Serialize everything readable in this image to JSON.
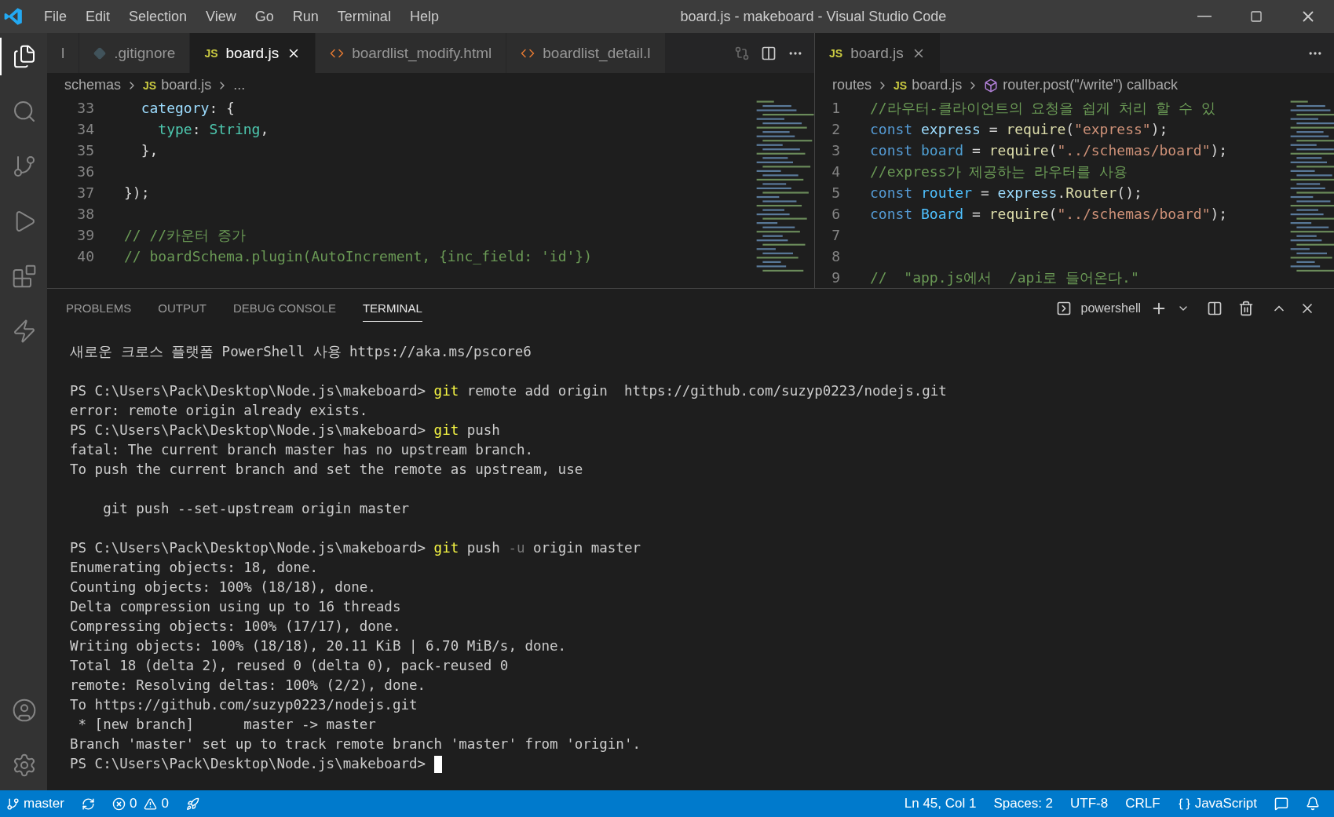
{
  "window": {
    "title": "board.js - makeboard - Visual Studio Code"
  },
  "menu": [
    "File",
    "Edit",
    "Selection",
    "View",
    "Go",
    "Run",
    "Terminal",
    "Help"
  ],
  "activity_bar": [
    {
      "kind": "files",
      "selected": true
    },
    {
      "kind": "search",
      "selected": false
    },
    {
      "kind": "source-control",
      "selected": false
    },
    {
      "kind": "run",
      "selected": false
    },
    {
      "kind": "extensions",
      "selected": false
    },
    {
      "kind": "bolt",
      "selected": false
    }
  ],
  "left_editor": {
    "tabs": [
      {
        "label": "l",
        "kind": "partial",
        "selected": false
      },
      {
        "label": ".gitignore",
        "kind": "git",
        "selected": false
      },
      {
        "label": "board.js",
        "kind": "js",
        "badge": "JS",
        "selected": true
      },
      {
        "label": "boardlist_modify.html",
        "kind": "html",
        "selected": false
      },
      {
        "label": "boardlist_detail.l",
        "kind": "html",
        "selected": false
      }
    ],
    "breadcrumb": [
      {
        "text": "schemas"
      },
      {
        "text": "board.js",
        "badge": "JS"
      },
      {
        "text": "..."
      }
    ],
    "lines": [
      {
        "number": "33",
        "tokens": [
          {
            "t": "  category",
            "kind": "prop"
          },
          {
            "t": ": {",
            "kind": "plain"
          }
        ]
      },
      {
        "number": "34",
        "tokens": [
          {
            "t": "    type",
            "kind": "prop2"
          },
          {
            "t": ": ",
            "kind": "plain"
          },
          {
            "t": "String",
            "kind": "type"
          },
          {
            "t": ",",
            "kind": "plain"
          }
        ]
      },
      {
        "number": "35",
        "tokens": [
          {
            "t": "  },",
            "kind": "plain"
          }
        ]
      },
      {
        "number": "36"
      },
      {
        "number": "37",
        "tokens": [
          {
            "t": "});",
            "kind": "plain"
          }
        ]
      },
      {
        "number": "38"
      },
      {
        "number": "39",
        "tokens": [
          {
            "t": "// //카운터 증가",
            "kind": "comment"
          }
        ]
      },
      {
        "number": "40",
        "tokens": [
          {
            "t": "// boardSchema.plugin(AutoIncrement, {inc_field: 'id'})",
            "kind": "comment"
          }
        ]
      }
    ]
  },
  "right_editor": {
    "tabs": [
      {
        "label": "board.js",
        "kind": "js",
        "badge": "JS",
        "selected": true
      }
    ],
    "breadcrumb": [
      {
        "text": "routes"
      },
      {
        "text": "board.js",
        "badge": "JS"
      },
      {
        "text": "router.post(\"/write\") callback",
        "kind": "symbol"
      }
    ],
    "lines": [
      {
        "number": "1",
        "tokens": [
          {
            "t": "//라우터-클라이언트의 요청을 쉽게 처리 할 수 있",
            "kind": "comment"
          }
        ]
      },
      {
        "number": "2",
        "tokens": [
          {
            "t": "const",
            "kind": "keyword"
          },
          {
            "t": " express",
            "kind": "var"
          },
          {
            "t": " = ",
            "kind": "plain"
          },
          {
            "t": "require",
            "kind": "func"
          },
          {
            "t": "(",
            "kind": "plain"
          },
          {
            "t": "\"express\"",
            "kind": "string"
          },
          {
            "t": ");",
            "kind": "plain"
          }
        ]
      },
      {
        "number": "3",
        "tokens": [
          {
            "t": "const",
            "kind": "keyword"
          },
          {
            "t": " board",
            "kind": "dimvar"
          },
          {
            "t": " = ",
            "kind": "plain"
          },
          {
            "t": "require",
            "kind": "func"
          },
          {
            "t": "(",
            "kind": "plain"
          },
          {
            "t": "\"../schemas/board\"",
            "kind": "string"
          },
          {
            "t": ");",
            "kind": "plain"
          }
        ]
      },
      {
        "number": "4",
        "tokens": [
          {
            "t": "//express가 제공하는 라우터를 사용",
            "kind": "comment"
          }
        ]
      },
      {
        "number": "5",
        "tokens": [
          {
            "t": "const",
            "kind": "keyword"
          },
          {
            "t": " router",
            "kind": "const"
          },
          {
            "t": " = ",
            "kind": "plain"
          },
          {
            "t": "express",
            "kind": "var"
          },
          {
            "t": ".",
            "kind": "plain"
          },
          {
            "t": "Router",
            "kind": "func"
          },
          {
            "t": "();",
            "kind": "plain"
          }
        ]
      },
      {
        "number": "6",
        "tokens": [
          {
            "t": "const",
            "kind": "keyword"
          },
          {
            "t": " Board",
            "kind": "const"
          },
          {
            "t": " = ",
            "kind": "plain"
          },
          {
            "t": "require",
            "kind": "func"
          },
          {
            "t": "(",
            "kind": "plain"
          },
          {
            "t": "\"../schemas/board\"",
            "kind": "string"
          },
          {
            "t": ");",
            "kind": "plain"
          }
        ]
      },
      {
        "number": "7"
      },
      {
        "number": "8"
      },
      {
        "number": "9",
        "tokens": [
          {
            "t": "//  \"app.js에서  /api로 들어온다.\"",
            "kind": "comment"
          }
        ]
      }
    ]
  },
  "panel": {
    "tabs": [
      {
        "label": "PROBLEMS",
        "selected": false
      },
      {
        "label": "OUTPUT",
        "selected": false
      },
      {
        "label": "DEBUG CONSOLE",
        "selected": false
      },
      {
        "label": "TERMINAL",
        "selected": true
      }
    ],
    "shell": "powershell",
    "terminal": [
      {
        "segments": [
          {
            "t": "새로운 크로스 플랫폼 PowerShell 사용 https://aka.ms/pscore6"
          }
        ]
      },
      {
        "gap_before": true,
        "segments": [
          {
            "t": "PS C:\\Users\\Pack\\Desktop\\Node.js\\makeboard> "
          },
          {
            "t": "git",
            "kind": "cmd"
          },
          {
            "t": " remote add origin  https://github.com/suzyp0223/nodejs.git"
          }
        ]
      },
      {
        "segments": [
          {
            "t": "error: remote origin already exists."
          }
        ]
      },
      {
        "segments": [
          {
            "t": "PS C:\\Users\\Pack\\Desktop\\Node.js\\makeboard> "
          },
          {
            "t": "git",
            "kind": "cmd"
          },
          {
            "t": " push"
          }
        ]
      },
      {
        "segments": [
          {
            "t": "fatal: The current branch master has no upstream branch."
          }
        ]
      },
      {
        "segments": [
          {
            "t": "To push the current branch and set the remote as upstream, use"
          }
        ]
      },
      {
        "gap_before": true,
        "segments": [
          {
            "t": "    git push --set-upstream origin master"
          }
        ]
      },
      {
        "gap_before": true,
        "segments": [
          {
            "t": "PS C:\\Users\\Pack\\Desktop\\Node.js\\makeboard> "
          },
          {
            "t": "git",
            "kind": "cmd"
          },
          {
            "t": " push "
          },
          {
            "t": "-u",
            "kind": "flag"
          },
          {
            "t": " origin master"
          }
        ]
      },
      {
        "segments": [
          {
            "t": "Enumerating objects: 18, done."
          }
        ]
      },
      {
        "segments": [
          {
            "t": "Counting objects: 100% (18/18), done."
          }
        ]
      },
      {
        "segments": [
          {
            "t": "Delta compression using up to 16 threads"
          }
        ]
      },
      {
        "segments": [
          {
            "t": "Compressing objects: 100% (17/17), done."
          }
        ]
      },
      {
        "segments": [
          {
            "t": "Writing objects: 100% (18/18), 20.11 KiB | 6.70 MiB/s, done."
          }
        ]
      },
      {
        "segments": [
          {
            "t": "Total 18 (delta 2), reused 0 (delta 0), pack-reused 0"
          }
        ]
      },
      {
        "segments": [
          {
            "t": "remote: Resolving deltas: 100% (2/2), done."
          }
        ]
      },
      {
        "segments": [
          {
            "t": "To https://github.com/suzyp0223/nodejs.git"
          }
        ]
      },
      {
        "segments": [
          {
            "t": " * [new branch]      master -> master"
          }
        ]
      },
      {
        "segments": [
          {
            "t": "Branch 'master' set up to track remote branch 'master' from 'origin'."
          }
        ]
      },
      {
        "segments": [
          {
            "t": "PS C:\\Users\\Pack\\Desktop\\Node.js\\makeboard> "
          }
        ],
        "cursor": true
      }
    ]
  },
  "status_bar": {
    "branch": "master",
    "errors": "0",
    "warnings": "0",
    "position": "Ln 45, Col 1",
    "spaces": "Spaces: 2",
    "encoding": "UTF-8",
    "eol": "CRLF",
    "language": "JavaScript"
  }
}
